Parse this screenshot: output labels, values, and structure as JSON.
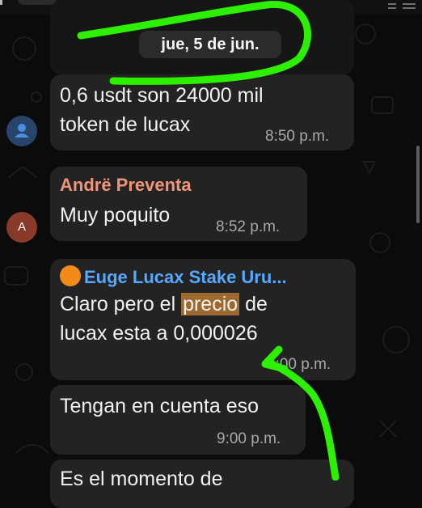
{
  "date_chip": "jue, 5 de jun.",
  "messages": [
    {
      "line1": "0,6 usdt son 24000 mil",
      "line2": "token de lucax",
      "time": "8:50 p.m."
    },
    {
      "sender": "Andrë Preventa",
      "sender_color": "#f0957a",
      "avatar_letter": "A",
      "text": "Muy poquito",
      "time": "8:52 p.m."
    },
    {
      "sender": "Euge Lucax Stake Uru...",
      "sender_color": "#57a8ff",
      "line1_pre": "Claro pero el ",
      "line1_hl": "precio",
      "line1_post": " de",
      "line2": "lucax esta a 0,000026",
      "time": "9:00 p.m."
    },
    {
      "text": "Tengan en cuenta eso",
      "time": "9:00 p.m."
    },
    {
      "text": "Es el momento de"
    }
  ],
  "colors": {
    "background": "#0b0b0b",
    "bubble": "#232323",
    "annotation": "#2cf000",
    "highlight": "#9c6a2e"
  }
}
